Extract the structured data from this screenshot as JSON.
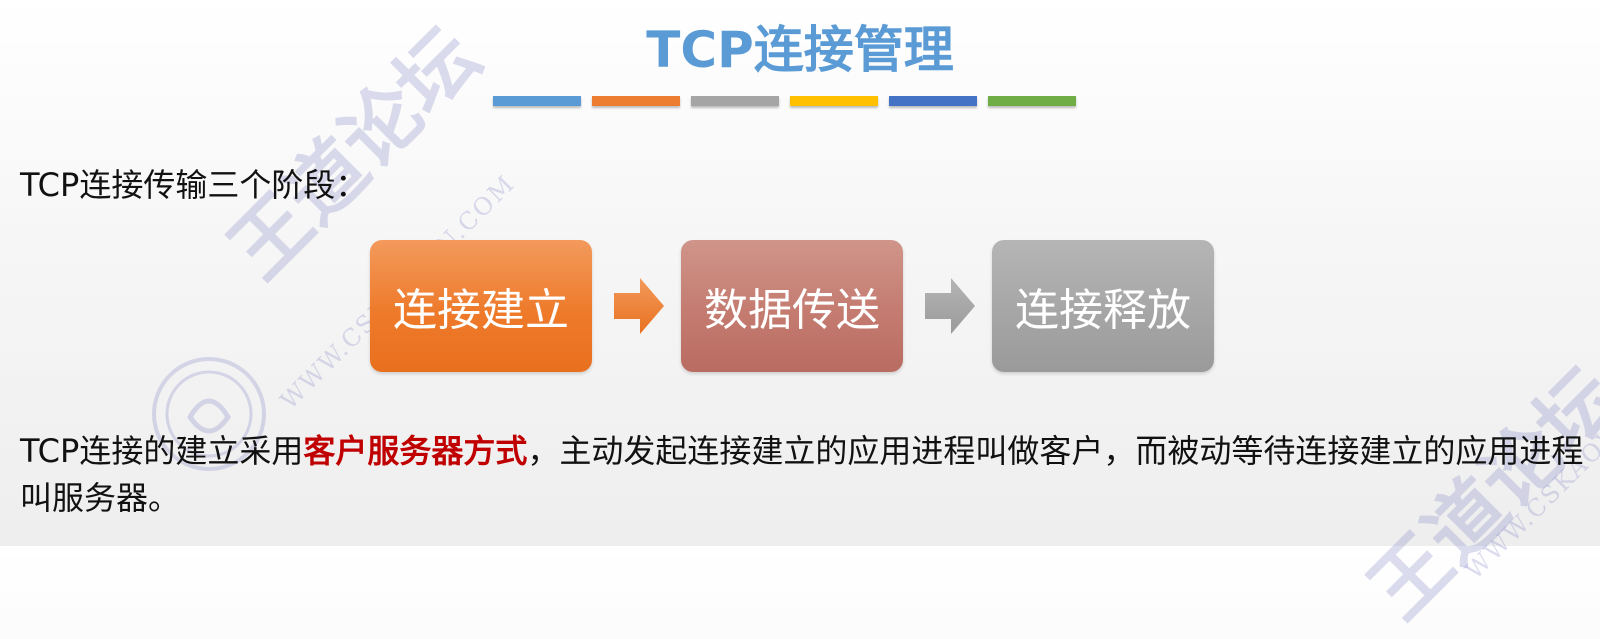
{
  "slide": {
    "title": "TCP连接管理",
    "title_color": "#5b9bd5",
    "accent_bars": [
      "#5b9bd5",
      "#ed7d31",
      "#a5a5a5",
      "#ffc000",
      "#4472c4",
      "#70ad47"
    ],
    "intro": "TCP连接传输三个阶段：",
    "stages": [
      {
        "label": "连接建立",
        "color": "#ee7a2a"
      },
      {
        "label": "数据传送",
        "color": "#c47b70"
      },
      {
        "label": "连接释放",
        "color": "#a6a6a6"
      }
    ],
    "paragraph": {
      "prefix": "TCP连接的建立采用",
      "highlight": "客户服务器方式",
      "highlight_color": "#c00000",
      "suffix": "，主动发起连接建立的应用进程叫做客户，而被动等待连接建立的应用进程叫服务器。"
    }
  },
  "watermark": {
    "brand": "王道论坛",
    "url": "WWW.CSKAOYAN.COM",
    "seal_text": "论坛"
  }
}
